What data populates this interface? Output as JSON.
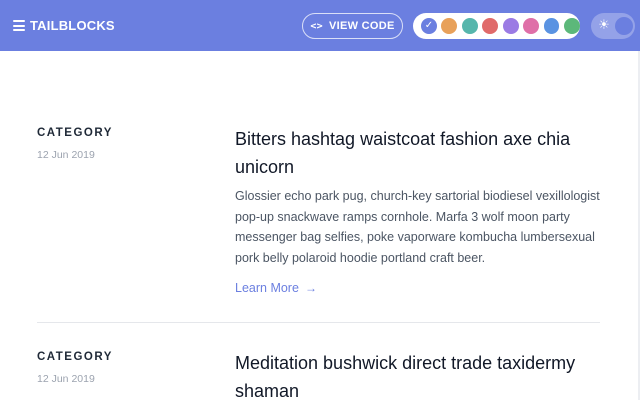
{
  "header": {
    "brand": "TAILBLOCKS",
    "view_code_label": "VIEW CODE",
    "view_code_icon": "<>",
    "menu_icon": "hamburger-icon",
    "theme_icon": "☀"
  },
  "palette": [
    {
      "name": "indigo",
      "color": "#6b7fe0",
      "selected": true,
      "check": "✓"
    },
    {
      "name": "orange",
      "color": "#e8a15a",
      "selected": false
    },
    {
      "name": "teal",
      "color": "#56b6ac",
      "selected": false
    },
    {
      "name": "red",
      "color": "#e06a6a",
      "selected": false
    },
    {
      "name": "purple",
      "color": "#9b7be4",
      "selected": false
    },
    {
      "name": "pink",
      "color": "#df6fa8",
      "selected": false
    },
    {
      "name": "blue",
      "color": "#5a93e2",
      "selected": false
    },
    {
      "name": "green",
      "color": "#5cb87a",
      "selected": false
    }
  ],
  "posts": [
    {
      "category": "CATEGORY",
      "date": "12 Jun 2019",
      "title": "Bitters hashtag waistcoat fashion axe chia unicorn",
      "excerpt": "Glossier echo park pug, church-key sartorial biodiesel vexillologist pop-up snackwave ramps cornhole. Marfa 3 wolf moon party messenger bag selfies, poke vaporware kombucha lumbersexual pork belly polaroid hoodie portland craft beer.",
      "link": "Learn More",
      "link_arrow": "→"
    },
    {
      "category": "CATEGORY",
      "date": "12 Jun 2019",
      "title": "Meditation bushwick direct trade taxidermy shaman"
    }
  ],
  "colors": {
    "accent": "#6b7fe0",
    "muted": "#9ca3af",
    "divider": "#e5e7eb"
  }
}
